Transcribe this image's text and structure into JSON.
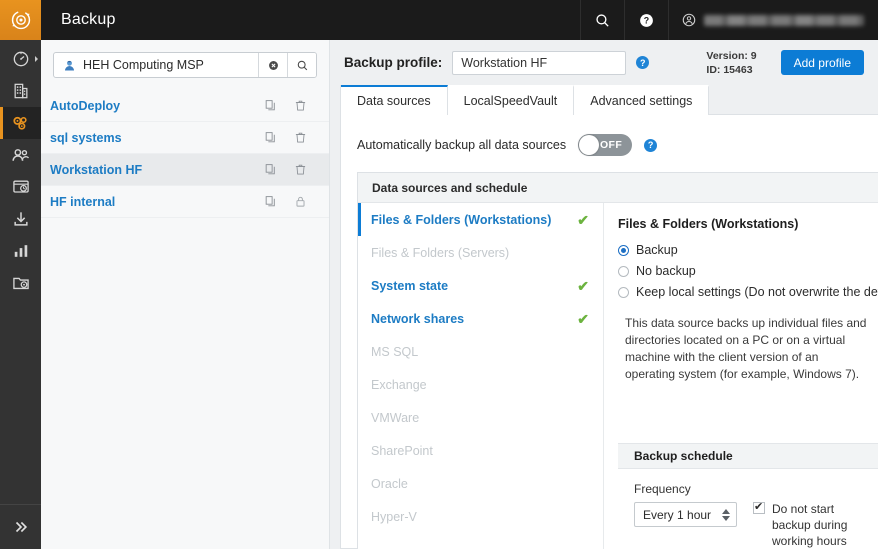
{
  "app": {
    "title": "Backup",
    "accent_blue": "#0c7cd5",
    "accent_orange": "#e8931f",
    "link_blue": "#1d7cc4",
    "check_green": "#6cb33f"
  },
  "rail": {
    "logo_icon": "backup-logo-icon",
    "items": [
      {
        "name": "dashboard",
        "icon": "gauge-icon",
        "has_arrow": true,
        "active": false
      },
      {
        "name": "organizations",
        "icon": "building-icon",
        "has_arrow": false,
        "active": false
      },
      {
        "name": "profiles",
        "icon": "gears-icon",
        "has_arrow": false,
        "active": true
      },
      {
        "name": "users",
        "icon": "users-icon",
        "has_arrow": false,
        "active": false
      },
      {
        "name": "devices",
        "icon": "monitor-clock-icon",
        "has_arrow": false,
        "active": false
      },
      {
        "name": "downloads",
        "icon": "download-icon",
        "has_arrow": false,
        "active": false
      },
      {
        "name": "reports",
        "icon": "bar-chart-icon",
        "has_arrow": false,
        "active": false
      },
      {
        "name": "restore",
        "icon": "folder-restore-icon",
        "has_arrow": false,
        "active": false
      }
    ],
    "expand_icon": "double-chevron-right-icon"
  },
  "topbar": {
    "title": "Backup",
    "search_icon": "search-icon",
    "help_icon": "help-circle-icon",
    "user_icon": "user-circle-icon",
    "user_name": ""
  },
  "search": {
    "value": "HEH Computing MSP",
    "placeholder": "Search",
    "avatar_icon": "customer-avatar-icon",
    "clear_icon": "clear-circle-icon",
    "submit_icon": "search-icon"
  },
  "profiles": {
    "copy_icon": "copy-icon",
    "delete_icon": "trash-icon",
    "lock_icon": "lock-icon",
    "items": [
      {
        "name": "AutoDeploy",
        "selected": false,
        "locked": false
      },
      {
        "name": "sql systems",
        "selected": false,
        "locked": false
      },
      {
        "name": "Workstation HF",
        "selected": true,
        "locked": false
      },
      {
        "name": "HF internal",
        "selected": false,
        "locked": true
      }
    ]
  },
  "profile_header": {
    "label": "Backup profile:",
    "name_value": "Workstation HF",
    "help_icon": "help-circle-icon",
    "help_glyph": "?",
    "version_line": "Version: 9",
    "id_line": "ID: 15463",
    "add_button": "Add profile"
  },
  "tabs": [
    {
      "label": "Data sources",
      "active": true
    },
    {
      "label": "LocalSpeedVault",
      "active": false
    },
    {
      "label": "Advanced settings",
      "active": false
    }
  ],
  "auto_backup": {
    "label": "Automatically backup all data sources",
    "toggle_state": "OFF",
    "help_glyph": "?"
  },
  "panel": {
    "title": "Data sources and schedule",
    "check_glyph": "✔",
    "data_sources": [
      {
        "label": "Files & Folders (Workstations)",
        "enabled": true,
        "checked": true,
        "active": true
      },
      {
        "label": "Files & Folders (Servers)",
        "enabled": false,
        "checked": false,
        "active": false
      },
      {
        "label": "System state",
        "enabled": true,
        "checked": true,
        "active": false
      },
      {
        "label": "Network shares",
        "enabled": true,
        "checked": true,
        "active": false
      },
      {
        "label": "MS SQL",
        "enabled": false,
        "checked": false,
        "active": false
      },
      {
        "label": "Exchange",
        "enabled": false,
        "checked": false,
        "active": false
      },
      {
        "label": "VMWare",
        "enabled": false,
        "checked": false,
        "active": false
      },
      {
        "label": "SharePoint",
        "enabled": false,
        "checked": false,
        "active": false
      },
      {
        "label": "Oracle",
        "enabled": false,
        "checked": false,
        "active": false
      },
      {
        "label": "Hyper-V",
        "enabled": false,
        "checked": false,
        "active": false
      }
    ],
    "detail": {
      "title": "Files & Folders (Workstations)",
      "options": [
        {
          "label": "Backup",
          "selected": true
        },
        {
          "label": "No backup",
          "selected": false
        },
        {
          "label": "Keep local settings (Do not overwrite the device)",
          "selected": false
        }
      ],
      "description": "This data source backs up individual files and directories located on a PC or on a virtual machine with the client version of an operating system (for example, Windows 7)."
    },
    "schedule": {
      "title": "Backup schedule",
      "frequency_label": "Frequency",
      "frequency_value": "Every 1 hour",
      "no_working_hours_label": "Do not start backup during working hours",
      "no_working_hours_checked": true
    }
  }
}
